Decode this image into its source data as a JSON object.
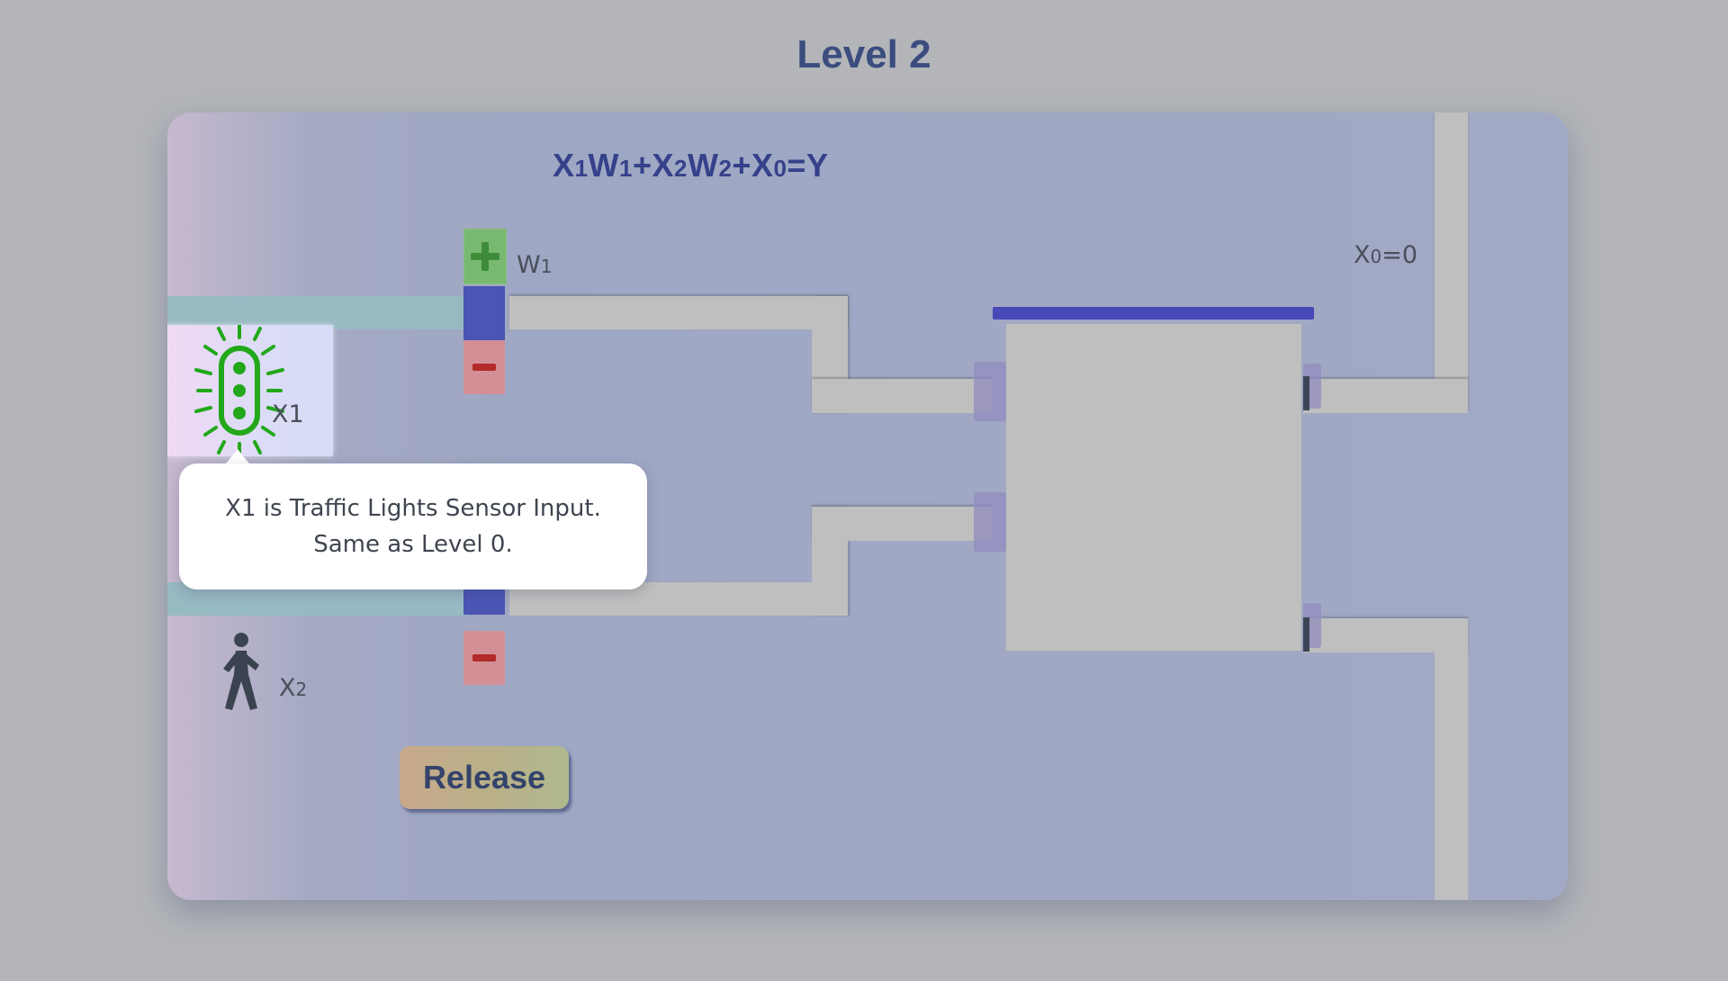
{
  "level_title": "Level 2",
  "equation": {
    "x1": "X",
    "x1_sub": "1",
    "w1": "W",
    "w1_sub": "1",
    "plus1": "+",
    "x2": "X",
    "x2_sub": "2",
    "w2": "W",
    "w2_sub": "2",
    "plus2": "+",
    "x0": "X",
    "x0_sub": "0",
    "eq": "=Y"
  },
  "labels": {
    "w1": "W",
    "w1_sub": "1",
    "x0": "X",
    "x0_sub": "0",
    "x0_value": "=0",
    "x1": "X1",
    "x2": "X",
    "x2_sub": "2"
  },
  "tooltip": {
    "line1": "X1 is Traffic Lights Sensor Input.",
    "line2": "Same as Level 0."
  },
  "release_label": "Release",
  "icons": {
    "x1_sensor": "traffic-light-icon",
    "x2_sensor": "pedestrian-icon",
    "w1_increase": "plus-icon",
    "w1_decrease": "minus-icon",
    "w2_decrease": "minus-icon"
  },
  "colors": {
    "title": "#3a4d7e",
    "equation": "#35418a",
    "traffic_light_active": "#22a81a",
    "neuron_bar": "#4848b8",
    "weight_blue": "#4a55b4",
    "plus_green": "#79b870",
    "minus_red": "#b32b28"
  }
}
